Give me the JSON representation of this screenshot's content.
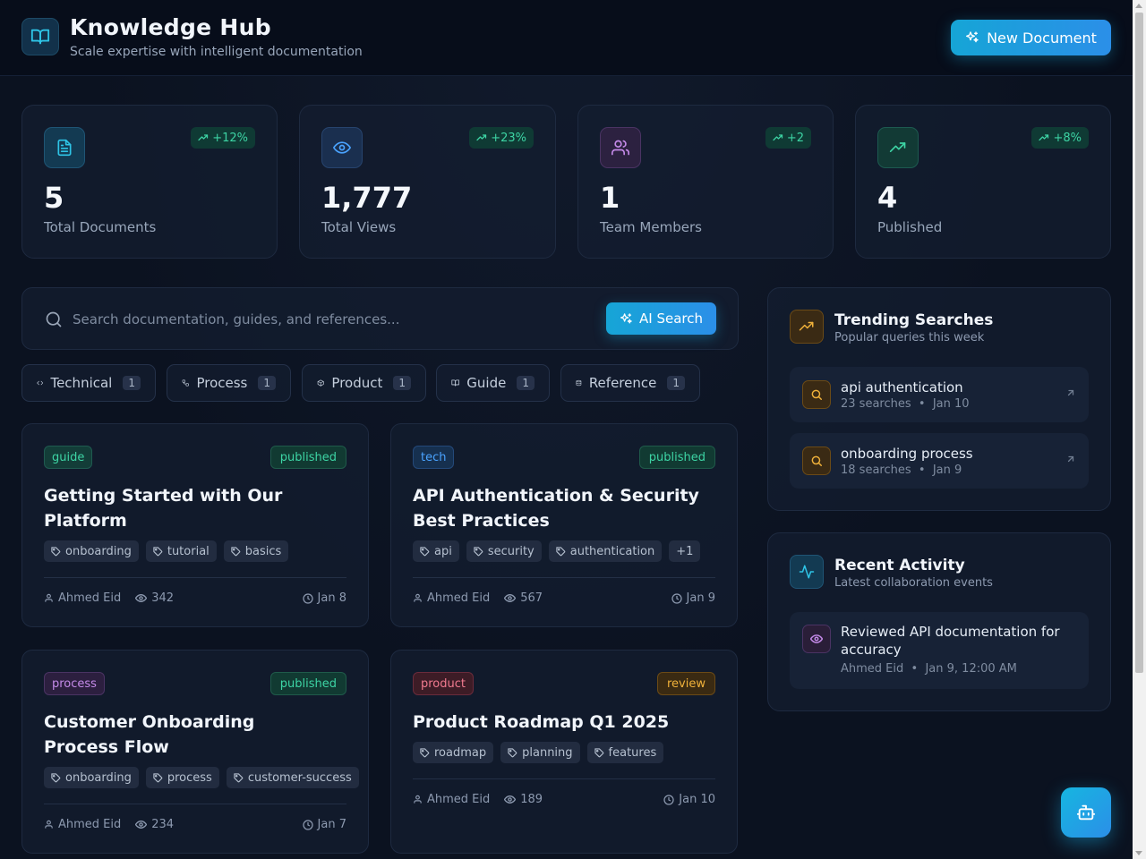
{
  "header": {
    "title": "Knowledge Hub",
    "subtitle": "Scale expertise with intelligent documentation",
    "new_doc_label": "New Document"
  },
  "stats": [
    {
      "value": "5",
      "label": "Total Documents",
      "change": "+12%",
      "icon": "document-icon",
      "color": "#2ec4e6"
    },
    {
      "value": "1,777",
      "label": "Total Views",
      "change": "+23%",
      "icon": "eye-icon",
      "color": "#4aa3ff"
    },
    {
      "value": "1",
      "label": "Team Members",
      "change": "+2",
      "icon": "users-icon",
      "color": "#c48ae8"
    },
    {
      "value": "4",
      "label": "Published",
      "change": "+8%",
      "icon": "trending-up-icon",
      "color": "#3dd4a4"
    }
  ],
  "search": {
    "placeholder": "Search documentation, guides, and references...",
    "button_label": "AI Search"
  },
  "filters": [
    {
      "label": "Technical",
      "count": "1",
      "icon": "code-icon"
    },
    {
      "label": "Process",
      "count": "1",
      "icon": "workflow-icon"
    },
    {
      "label": "Product",
      "count": "1",
      "icon": "package-icon"
    },
    {
      "label": "Guide",
      "count": "1",
      "icon": "book-icon"
    },
    {
      "label": "Reference",
      "count": "1",
      "icon": "database-icon"
    }
  ],
  "documents": [
    {
      "category": "guide",
      "status": "published",
      "title": "Getting Started with Our Platform",
      "tags": [
        "onboarding",
        "tutorial",
        "basics"
      ],
      "author": "Ahmed Eid",
      "views": "342",
      "date": "Jan 8"
    },
    {
      "category": "tech",
      "status": "published",
      "title": "API Authentication & Security Best Practices",
      "tags": [
        "api",
        "security",
        "authentication",
        "+1"
      ],
      "author": "Ahmed Eid",
      "views": "567",
      "date": "Jan 9"
    },
    {
      "category": "process",
      "status": "published",
      "title": "Customer Onboarding Process Flow",
      "tags": [
        "onboarding",
        "process",
        "customer-success"
      ],
      "author": "Ahmed Eid",
      "views": "234",
      "date": "Jan 7"
    },
    {
      "category": "product",
      "status": "review",
      "title": "Product Roadmap Q1 2025",
      "tags": [
        "roadmap",
        "planning",
        "features"
      ],
      "author": "Ahmed Eid",
      "views": "189",
      "date": "Jan 10"
    }
  ],
  "trending": {
    "title": "Trending Searches",
    "subtitle": "Popular queries this week",
    "items": [
      {
        "query": "api authentication",
        "count": "23 searches",
        "date": "Jan 10"
      },
      {
        "query": "onboarding process",
        "count": "18 searches",
        "date": "Jan 9"
      }
    ]
  },
  "activity": {
    "title": "Recent Activity",
    "subtitle": "Latest collaboration events",
    "items": [
      {
        "text": "Reviewed API documentation for accuracy",
        "user": "Ahmed Eid",
        "time": "Jan 9, 12:00 AM"
      }
    ]
  },
  "separator": "•"
}
